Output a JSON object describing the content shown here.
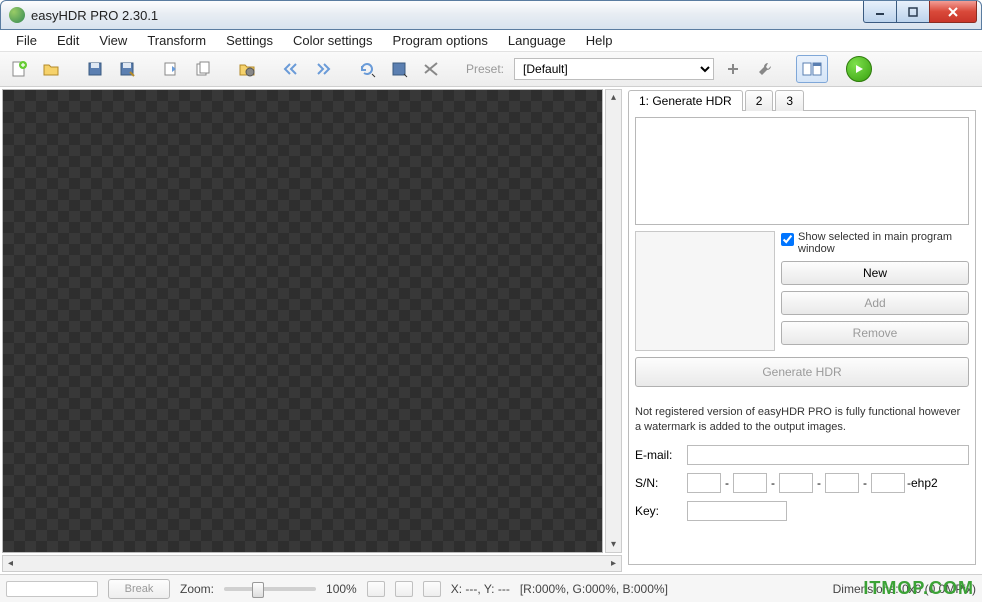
{
  "window": {
    "title": "easyHDR PRO 2.30.1"
  },
  "menu": [
    "File",
    "Edit",
    "View",
    "Transform",
    "Settings",
    "Color settings",
    "Program options",
    "Language",
    "Help"
  ],
  "toolbar": {
    "preset_label": "Preset:",
    "preset_value": "[Default]"
  },
  "tabs": {
    "t1": "1: Generate HDR",
    "t2": "2",
    "t3": "3"
  },
  "panel": {
    "show_selected": "Show selected in main program window",
    "new": "New",
    "add": "Add",
    "remove": "Remove",
    "generate": "Generate HDR"
  },
  "reg": {
    "note": "Not registered version of easyHDR PRO is fully functional however a watermark is added to the output images.",
    "email_label": "E-mail:",
    "email_value": "",
    "sn_label": "S/N:",
    "sn_suffix": "-ehp2",
    "key_label": "Key:"
  },
  "status": {
    "break": "Break",
    "zoom_label": "Zoom:",
    "zoom_value": "100%",
    "xy": "X: ---, Y: ---",
    "rgb": "[R:000%, G:000%, B:000%]",
    "dim": "Dimensions: 0x0 (0.0MPix)"
  },
  "watermark": "ITMOP.COM"
}
